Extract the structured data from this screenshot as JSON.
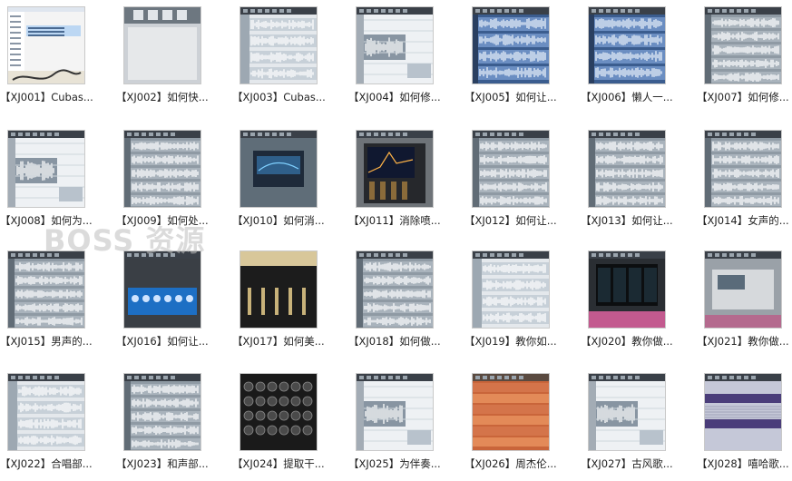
{
  "watermark": "BOSS 资源",
  "files": [
    {
      "label": "【XJ001】Cubas...",
      "style": "explorer"
    },
    {
      "label": "【XJ002】如何快...",
      "style": "panel"
    },
    {
      "label": "【XJ003】Cubas...",
      "style": "daw_light"
    },
    {
      "label": "【XJ004】如何修...",
      "style": "daw_split"
    },
    {
      "label": "【XJ005】如何让...",
      "style": "daw_blue"
    },
    {
      "label": "【XJ006】懒人一...",
      "style": "daw_blue"
    },
    {
      "label": "【XJ007】如何修...",
      "style": "daw_gray"
    },
    {
      "label": "【XJ008】如何为...",
      "style": "daw_split"
    },
    {
      "label": "【XJ009】如何处...",
      "style": "daw_gray"
    },
    {
      "label": "【XJ010】如何消...",
      "style": "plugin_dark"
    },
    {
      "label": "【XJ011】消除喷...",
      "style": "plugin_eq"
    },
    {
      "label": "【XJ012】如何让...",
      "style": "daw_gray"
    },
    {
      "label": "【XJ013】如何让...",
      "style": "daw_gray"
    },
    {
      "label": "【XJ014】女声的...",
      "style": "daw_gray"
    },
    {
      "label": "【XJ015】男声的...",
      "style": "daw_gray"
    },
    {
      "label": "【XJ016】如何让...",
      "style": "plugin_blue"
    },
    {
      "label": "【XJ017】如何美...",
      "style": "plugin_gold"
    },
    {
      "label": "【XJ018】如何做...",
      "style": "daw_gray"
    },
    {
      "label": "【XJ019】教你如...",
      "style": "daw_light"
    },
    {
      "label": "【XJ020】教你做...",
      "style": "plugin_black"
    },
    {
      "label": "【XJ021】教你做...",
      "style": "plugin_pink"
    },
    {
      "label": "【XJ022】合唱部...",
      "style": "daw_light"
    },
    {
      "label": "【XJ023】和声部...",
      "style": "daw_gray"
    },
    {
      "label": "【XJ024】提取干...",
      "style": "plugin_knobs"
    },
    {
      "label": "【XJ025】为伴奏...",
      "style": "daw_split"
    },
    {
      "label": "【XJ026】周杰伦...",
      "style": "daw_orange"
    },
    {
      "label": "【XJ027】古风歌...",
      "style": "daw_split"
    },
    {
      "label": "【XJ028】嘻哈歌...",
      "style": "daw_purple"
    }
  ]
}
